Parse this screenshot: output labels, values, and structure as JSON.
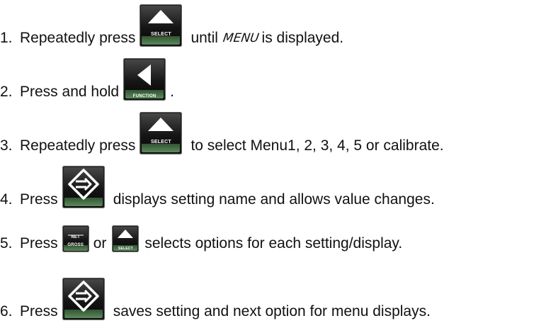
{
  "steps": [
    {
      "number": "1.",
      "before": "Repeatedly press",
      "mid": "until",
      "menu_word": "MENU",
      "after": "is displayed.",
      "icon_label": "SELECT",
      "icon": "up-arrow-icon"
    },
    {
      "number": "2.",
      "before": "Press and hold",
      "after": ".",
      "icon_label": "FUNCTION",
      "icon": "left-arrow-icon"
    },
    {
      "number": "3.",
      "before": "Repeatedly press",
      "after": "to select Menu1, 2, 3, 4, 5 or calibrate.",
      "icon_label": "SELECT",
      "icon": "up-arrow-icon"
    },
    {
      "number": "4.",
      "before": "Press",
      "after": "displays setting name and allows value changes.",
      "icon": "enter-arrow-icon"
    },
    {
      "number": "5.",
      "before": "Press",
      "connector": "or",
      "after": "selects options for each setting/display.",
      "net_label": "NET",
      "gross_label": "GROSS",
      "icon_label": "SELECT",
      "icon": "up-arrow-icon"
    },
    {
      "number": "6.",
      "before": "Press",
      "after": "saves setting and next option for menu displays.",
      "icon": "enter-arrow-icon"
    }
  ]
}
